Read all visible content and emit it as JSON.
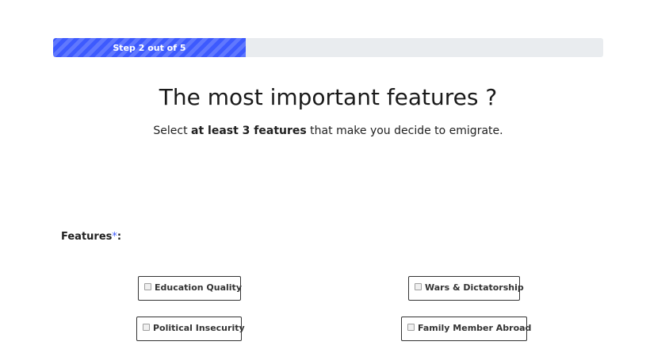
{
  "progress": {
    "label": "Step 2 out of 5",
    "fraction": 0.35,
    "accent_color": "#3d5afe"
  },
  "heading": {
    "title": "The most important features ?",
    "subtitle_before": "Select ",
    "subtitle_bold": "at least 3 features",
    "subtitle_after": " that make you decide to emigrate."
  },
  "form": {
    "features_label": "Features",
    "required_marker": "*",
    "label_suffix": ":",
    "options": [
      {
        "label": "Education Quality",
        "checked": false
      },
      {
        "label": "Wars & Dictatorship",
        "checked": false
      },
      {
        "label": "Political Insecurity",
        "checked": false
      },
      {
        "label": "Family Member Abroad",
        "checked": false
      }
    ]
  }
}
